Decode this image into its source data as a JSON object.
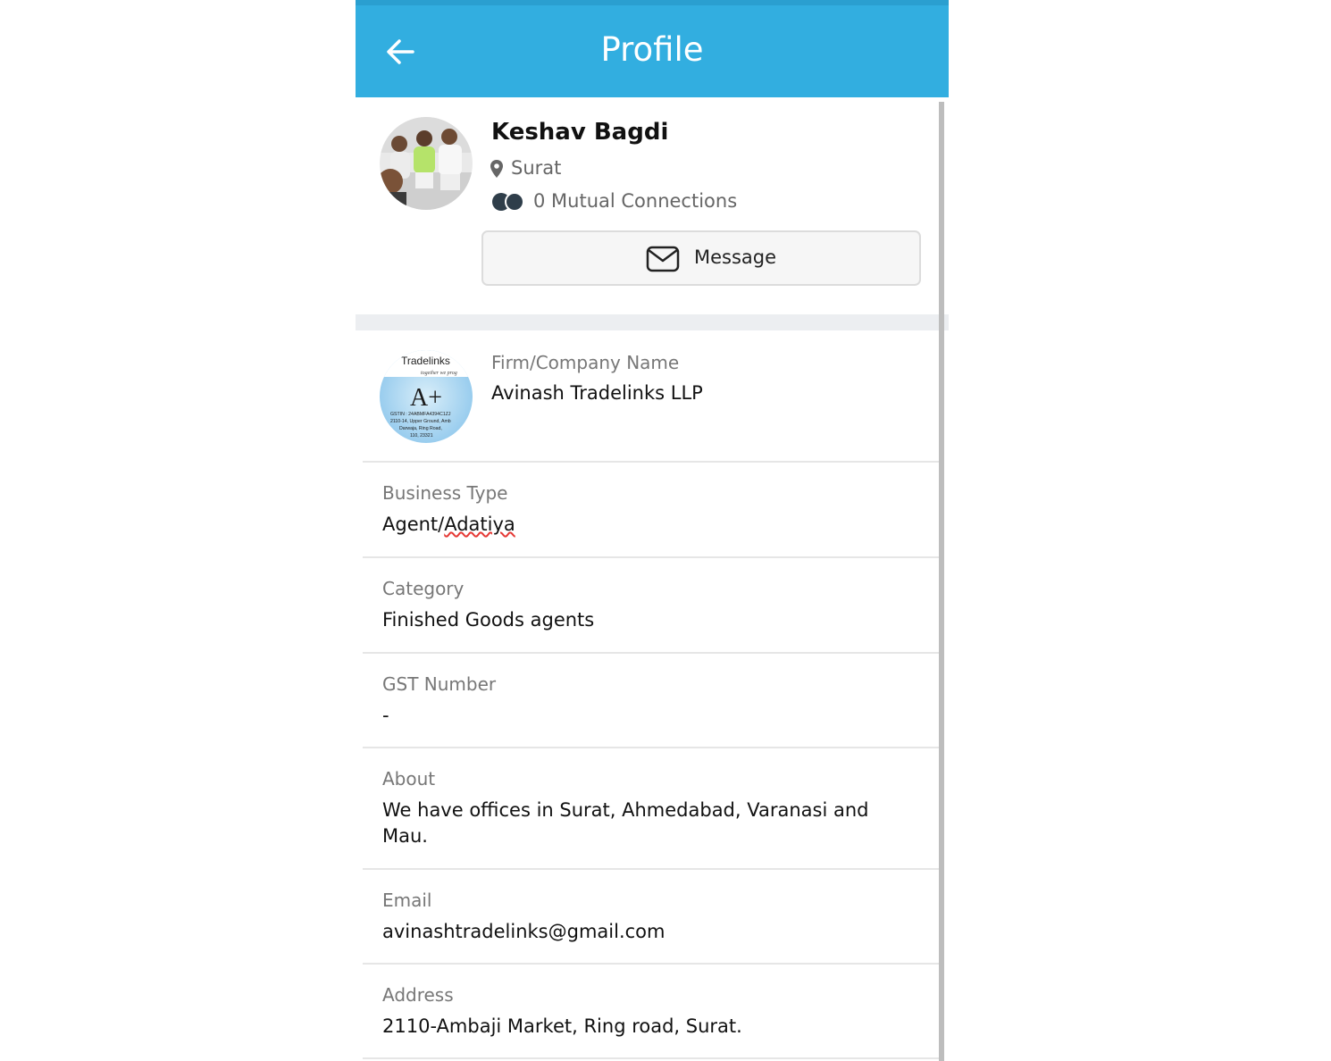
{
  "app": {
    "title": "Profile"
  },
  "icons": {
    "back": "back-arrow-icon",
    "location": "location-pin-icon",
    "mutual": "mutual-connections-icon",
    "message": "envelope-icon"
  },
  "colors": {
    "appbar": "#32aee0",
    "accent_dark": "#2a9fd0"
  },
  "profile": {
    "name": "Keshav Bagdi",
    "location": "Surat",
    "mutual_connections": "0 Mutual Connections",
    "message_label": "Message"
  },
  "firm": {
    "label": "Firm/Company Name",
    "value": "Avinash Tradelinks LLP",
    "logo_text": {
      "top": "Tradelinks",
      "tagline": "together we prog",
      "mark": "A+",
      "gstin": "GSTIN : 24ABMFA4394C1ZJ",
      "addr1": "2110-14, Upper Ground, Amb",
      "addr2": "Darwaja, Ring Road,",
      "addr3": "110, 23321"
    }
  },
  "details": [
    {
      "label": "Business Type",
      "value_prefix": "Agent/",
      "value_marked": "Adatiya"
    },
    {
      "label": "Category",
      "value": "Finished Goods agents"
    },
    {
      "label": "GST Number",
      "value": "-"
    },
    {
      "label": "About",
      "value": "We have offices in Surat, Ahmedabad, Varanasi and Mau."
    },
    {
      "label": "Email",
      "value": "avinashtradelinks@gmail.com"
    },
    {
      "label": "Address",
      "value": "2110-Ambaji Market, Ring road, Surat."
    }
  ]
}
